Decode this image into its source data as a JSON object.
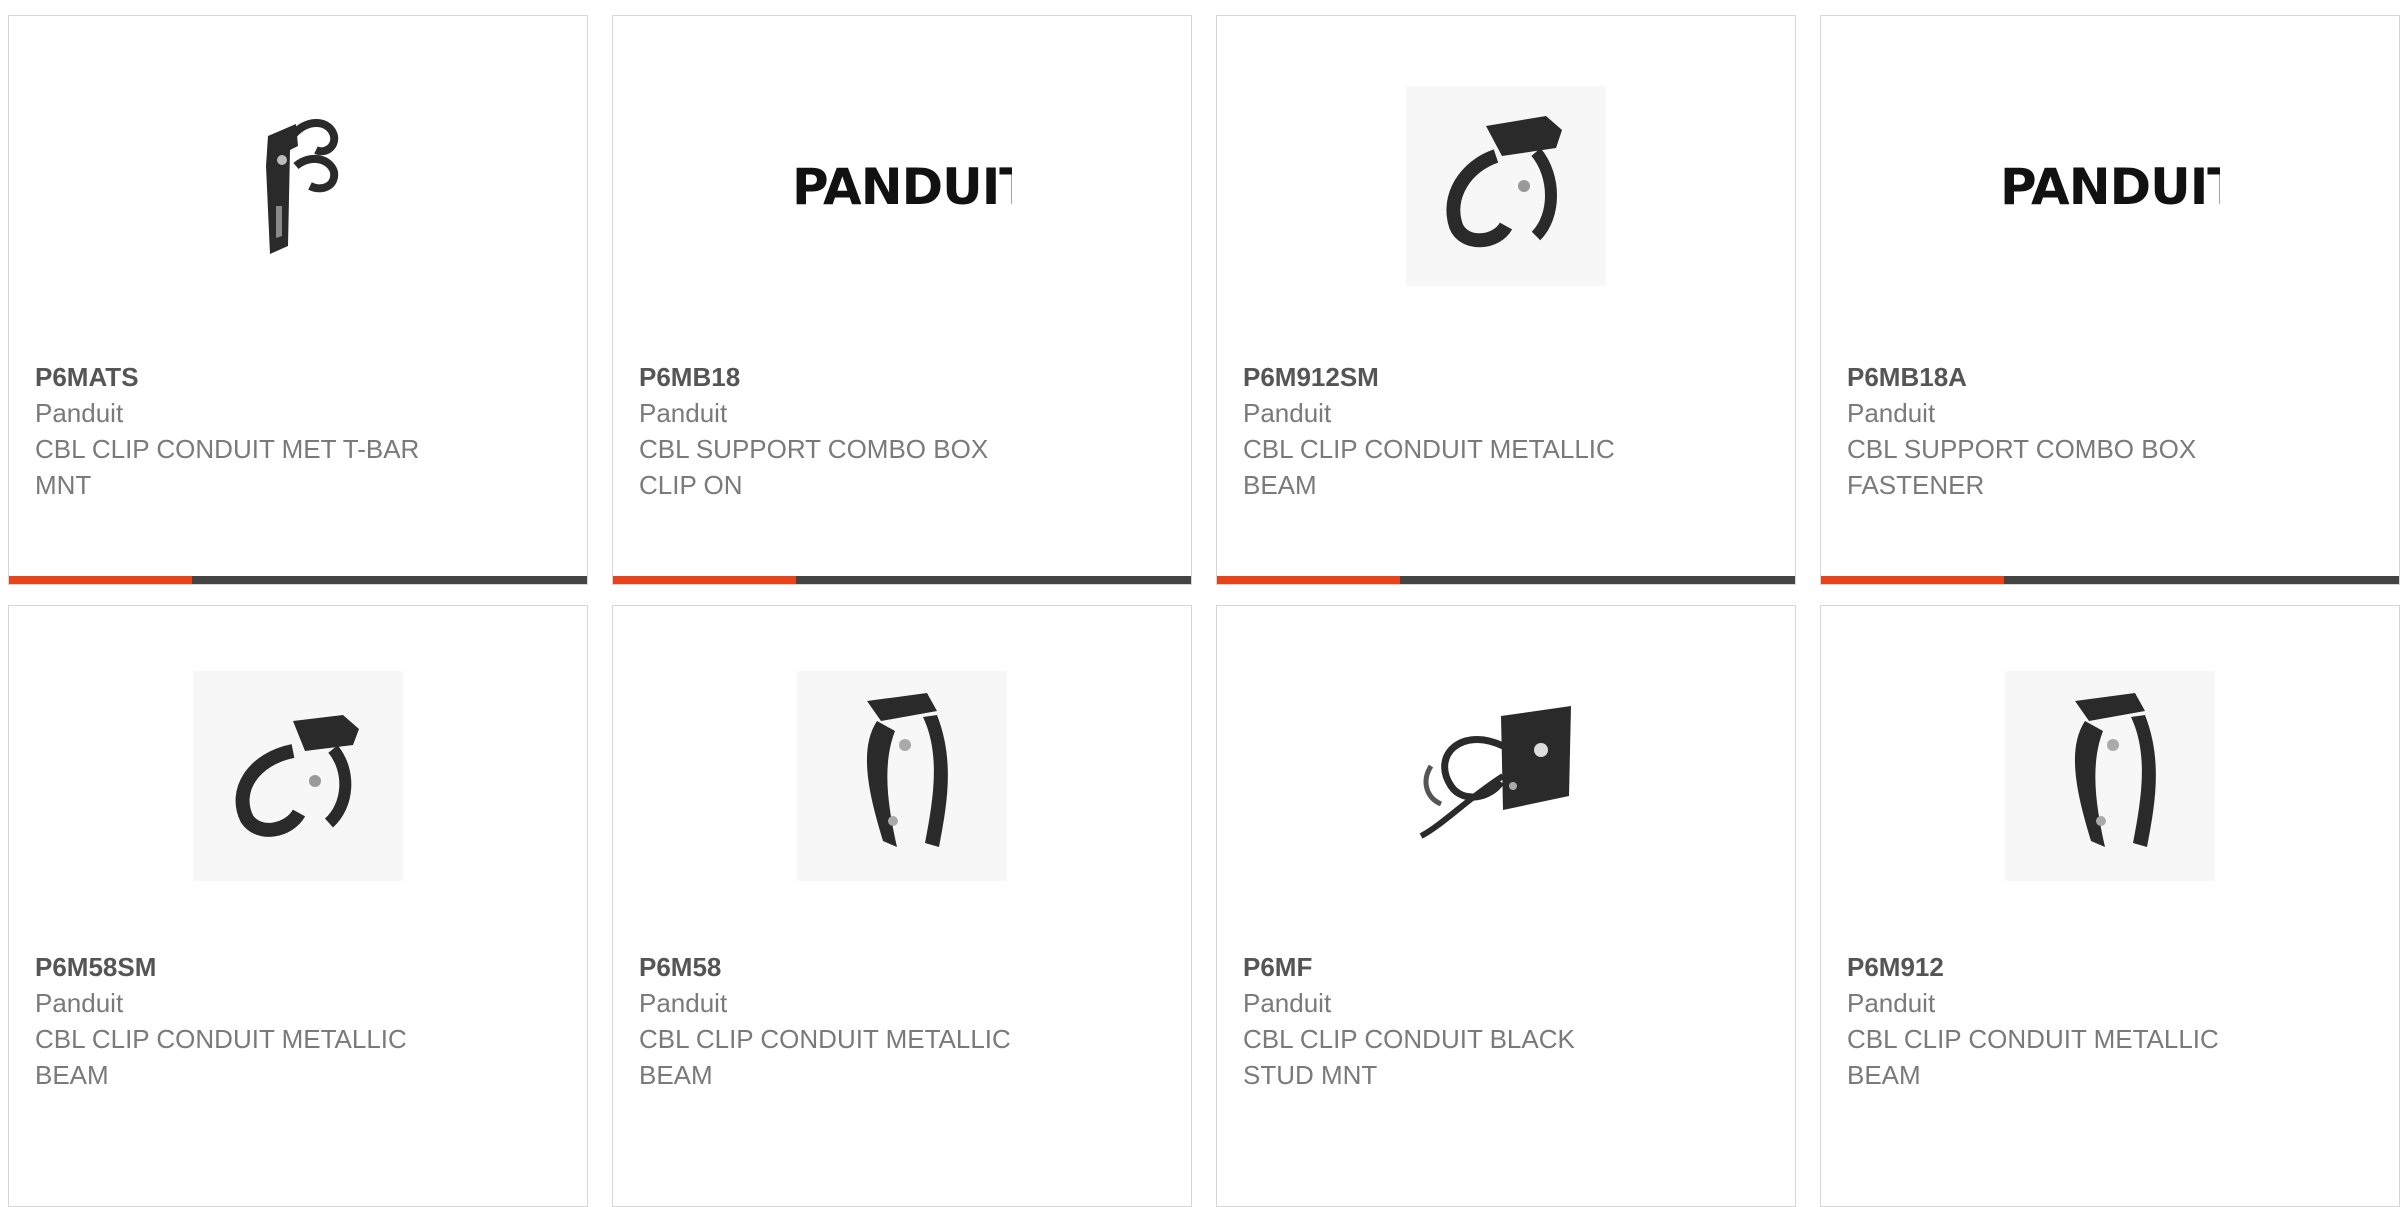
{
  "brand_colors": {
    "accent": "#e8441b",
    "bar": "#444444",
    "border": "#d6d6d6",
    "part_number": "#555555",
    "text": "#7a7a7a"
  },
  "products": [
    {
      "part_number": "P6MATS",
      "manufacturer": "Panduit",
      "description": "CBL CLIP CONDUIT MET T-BAR\nMNT",
      "image": "tbar-clip-photo"
    },
    {
      "part_number": "P6MB18",
      "manufacturer": "Panduit",
      "description": "CBL SUPPORT COMBO BOX\nCLIP ON",
      "image": "panduit-logo",
      "logo_text": "PANDUIT"
    },
    {
      "part_number": "P6M912SM",
      "manufacturer": "Panduit",
      "description": "CBL CLIP CONDUIT METALLIC\nBEAM",
      "image": "beam-clip-photo"
    },
    {
      "part_number": "P6MB18A",
      "manufacturer": "Panduit",
      "description": "CBL SUPPORT COMBO BOX\nFASTENER",
      "image": "panduit-logo",
      "logo_text": "PANDUIT"
    },
    {
      "part_number": "P6M58SM",
      "manufacturer": "Panduit",
      "description": "CBL CLIP CONDUIT METALLIC\nBEAM",
      "image": "beam-clip-photo"
    },
    {
      "part_number": "P6M58",
      "manufacturer": "Panduit",
      "description": "CBL CLIP CONDUIT METALLIC\nBEAM",
      "image": "vertical-clip-photo"
    },
    {
      "part_number": "P6MF",
      "manufacturer": "Panduit",
      "description": "CBL CLIP CONDUIT BLACK\nSTUD MNT",
      "image": "stud-clip-photo"
    },
    {
      "part_number": "P6M912",
      "manufacturer": "Panduit",
      "description": "CBL CLIP CONDUIT METALLIC\nBEAM",
      "image": "vertical-clip-photo"
    }
  ]
}
